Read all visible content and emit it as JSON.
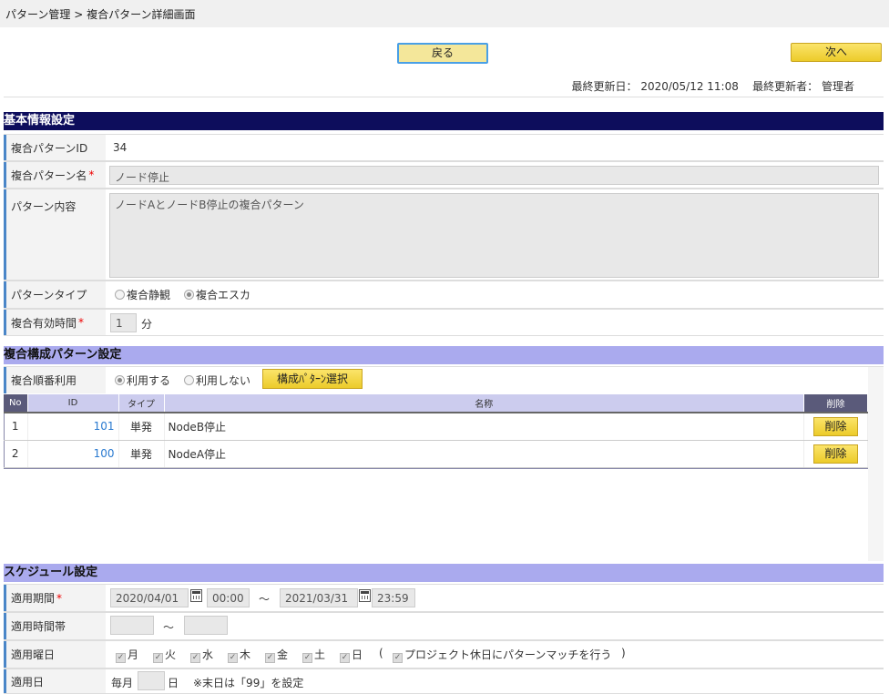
{
  "breadcrumb": "パターン管理 > 複合パターン詳細画面",
  "buttons": {
    "back": "戻る",
    "next": "次へ"
  },
  "meta": {
    "updated_label": "最終更新日：",
    "updated_value": "2020/05/12 11:08",
    "updater_label": "最終更新者：",
    "updater_value": "管理者"
  },
  "basic": {
    "title": "基本情報設定",
    "id_label": "複合パターンID",
    "id_value": "34",
    "name_label": "複合パターン名",
    "name_value": "ノード停止",
    "content_label": "パターン内容",
    "content_value": "ノードAとノードB停止の複合パターン",
    "type_label": "パターンタイプ",
    "type_options": [
      "複合静観",
      "複合エスカ"
    ],
    "type_selected": "複合エスカ",
    "valid_label": "複合有効時間",
    "valid_value": "1",
    "valid_unit": "分"
  },
  "composite": {
    "title": "複合構成パターン設定",
    "order_label": "複合順番利用",
    "order_options": [
      "利用する",
      "利用しない"
    ],
    "order_selected": "利用する",
    "select_button": "構成ﾊﾟﾀｰﾝ選択",
    "columns": [
      "No",
      "ID",
      "タイプ",
      "名称",
      "削除"
    ],
    "rows": [
      {
        "no": "1",
        "id": "101",
        "type": "単発",
        "name": "NodeB停止",
        "del": "削除"
      },
      {
        "no": "2",
        "id": "100",
        "type": "単発",
        "name": "NodeA停止",
        "del": "削除"
      }
    ]
  },
  "schedule": {
    "title": "スケジュール設定",
    "period_label": "適用期間",
    "start_date": "2020/04/01",
    "start_time": "00:00",
    "tilde": "～",
    "end_date": "2021/03/31",
    "end_time": "23:59",
    "timeband_label": "適用時間帯",
    "weekday_label": "適用曜日",
    "weekdays": [
      "月",
      "火",
      "水",
      "木",
      "金",
      "土",
      "日"
    ],
    "holiday_open": "(",
    "holiday_text": "プロジェクト休日にパターンマッチを行う",
    "holiday_close": ")",
    "day_label": "適用日",
    "day_prefix": "毎月",
    "day_suffix": "日",
    "day_note": "※末日は「99」を設定"
  },
  "colors": {
    "section_dark": "#0d0d5c",
    "section_light": "#aaaaee",
    "button_yellow": "#f4d43a",
    "link": "#2a7ad0"
  }
}
